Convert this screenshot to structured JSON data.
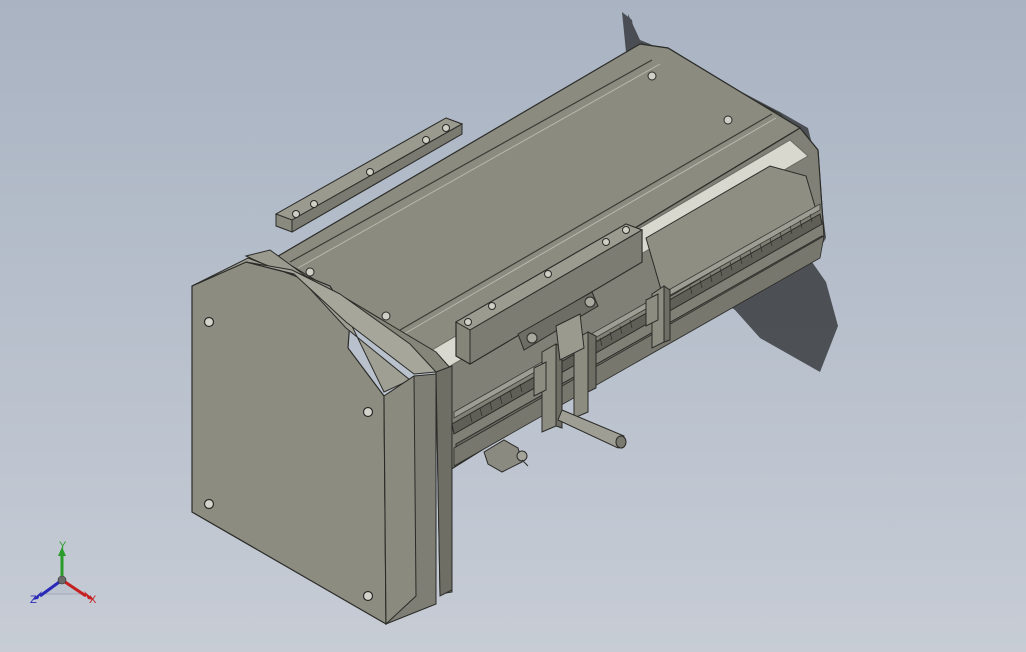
{
  "viewport": {
    "background_top": "#a9b3c2",
    "background_bottom": "#c7ccd5"
  },
  "model": {
    "body_color": "#8f8f84",
    "top_color": "#8b8b80",
    "shadow_color": "#3a3c40"
  },
  "triad": {
    "x_label": "X",
    "y_label": "Y",
    "z_label": "Z",
    "x_color": "#c42020",
    "y_color": "#2a9c2a",
    "z_color": "#2a2ab8"
  }
}
